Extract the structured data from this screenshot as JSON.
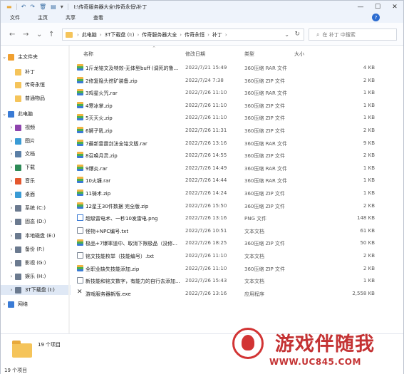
{
  "titlebar": {
    "path": "I:\\传奇服务器大全\\传奇永恒\\补丁",
    "icons": [
      "folder-icon",
      "undo-icon",
      "redo-icon",
      "delete-icon",
      "properties-icon",
      "dropdown-icon"
    ]
  },
  "window_controls": {
    "minimize": "—",
    "maximize": "☐",
    "close": "✕"
  },
  "ribbon": {
    "tabs": [
      "文件",
      "主页",
      "共享",
      "查看"
    ],
    "help": "?"
  },
  "nav": {
    "back": "←",
    "forward": "→",
    "recent": "⌄",
    "up": "↑"
  },
  "address": {
    "crumbs": [
      "此电脑",
      "3T下载盘 (I:)",
      "传奇服务器大全",
      "传奇永恒",
      "补丁"
    ],
    "separator": "›",
    "dropdown": "⌄",
    "refresh": "↻"
  },
  "search": {
    "placeholder": "在 补丁 中搜索",
    "icon": "⌕"
  },
  "sidebar": {
    "items": [
      {
        "label": "主文件夹",
        "chev": "⌄",
        "icon": "home",
        "color": "#f0a030",
        "indent": 0
      },
      {
        "label": "补丁",
        "chev": "",
        "icon": "folder",
        "color": "#f5c45a",
        "indent": 1
      },
      {
        "label": "传奇永恒",
        "chev": "",
        "icon": "folder",
        "color": "#f5c45a",
        "indent": 1
      },
      {
        "label": "普通物品",
        "chev": "",
        "icon": "folder",
        "color": "#f5c45a",
        "indent": 1
      },
      {
        "label": "此电脑",
        "chev": "⌄",
        "icon": "pc",
        "color": "#3a7bd5",
        "indent": 0
      },
      {
        "label": "视频",
        "chev": "›",
        "icon": "video",
        "color": "#8e44ad",
        "indent": 1
      },
      {
        "label": "图片",
        "chev": "›",
        "icon": "pictures",
        "color": "#3a9bd5",
        "indent": 1
      },
      {
        "label": "文档",
        "chev": "›",
        "icon": "documents",
        "color": "#5b7fa6",
        "indent": 1
      },
      {
        "label": "下载",
        "chev": "›",
        "icon": "download",
        "color": "#2e8b57",
        "indent": 1
      },
      {
        "label": "音乐",
        "chev": "›",
        "icon": "music",
        "color": "#e4572e",
        "indent": 1
      },
      {
        "label": "桌面",
        "chev": "›",
        "icon": "desktop",
        "color": "#3a9bd5",
        "indent": 1
      },
      {
        "label": "系统 (C:)",
        "chev": "›",
        "icon": "drive",
        "color": "#6b7a8f",
        "indent": 1
      },
      {
        "label": "固态 (D:)",
        "chev": "›",
        "icon": "drive",
        "color": "#6b7a8f",
        "indent": 1
      },
      {
        "label": "本地磁盘 (E:)",
        "chev": "›",
        "icon": "drive",
        "color": "#6b7a8f",
        "indent": 1
      },
      {
        "label": "备份 (F:)",
        "chev": "›",
        "icon": "drive",
        "color": "#6b7a8f",
        "indent": 1
      },
      {
        "label": "影视 (G:)",
        "chev": "›",
        "icon": "drive",
        "color": "#6b7a8f",
        "indent": 1
      },
      {
        "label": "娱乐 (H:)",
        "chev": "›",
        "icon": "drive",
        "color": "#6b7a8f",
        "indent": 1
      },
      {
        "label": "3T下载盘 (I:)",
        "chev": "›",
        "icon": "drive",
        "color": "#6b7a8f",
        "indent": 1,
        "selected": true
      },
      {
        "label": "网络",
        "chev": "›",
        "icon": "network",
        "color": "#3a7bd5",
        "indent": 0
      }
    ]
  },
  "columns": {
    "name": "名称",
    "date": "修改日期",
    "type": "类型",
    "size": "大小",
    "sort_caret": "^"
  },
  "files": [
    {
      "name": "1斤龙铭文及特效-无体型buff (调死的鲁...",
      "date": "2022/7/21 15:49",
      "type": "360压缩 RAR 文件",
      "size": "4 KB",
      "kind": "archive"
    },
    {
      "name": "2修复隐头挖矿装备.zip",
      "date": "2022/7/24 7:38",
      "type": "360压缩 ZIP 文件",
      "size": "2 KB",
      "kind": "archive"
    },
    {
      "name": "3鸡星火咒.rar",
      "date": "2022/7/26 11:10",
      "type": "360压缩 RAR 文件",
      "size": "1 KB",
      "kind": "archive"
    },
    {
      "name": "4寒冰掌.zip",
      "date": "2022/7/26 11:10",
      "type": "360压缩 ZIP 文件",
      "size": "1 KB",
      "kind": "archive"
    },
    {
      "name": "5灭天火.zip",
      "date": "2022/7/26 11:10",
      "type": "360压缩 ZIP 文件",
      "size": "1 KB",
      "kind": "archive"
    },
    {
      "name": "6狮子吼.zip",
      "date": "2022/7/26 11:31",
      "type": "360压缩 ZIP 文件",
      "size": "2 KB",
      "kind": "archive"
    },
    {
      "name": "7最新雷霆剑法全铭文版.rar",
      "date": "2022/7/26 13:16",
      "type": "360压缩 RAR 文件",
      "size": "9 KB",
      "kind": "archive"
    },
    {
      "name": "8召唤月灵.zip",
      "date": "2022/7/26 14:55",
      "type": "360压缩 ZIP 文件",
      "size": "2 KB",
      "kind": "archive"
    },
    {
      "name": "9爆炎.rar",
      "date": "2022/7/26 14:49",
      "type": "360压缩 RAR 文件",
      "size": "1 KB",
      "kind": "archive"
    },
    {
      "name": "10火镰.rar",
      "date": "2022/7/26 14:44",
      "type": "360压缩 RAR 文件",
      "size": "1 KB",
      "kind": "archive"
    },
    {
      "name": "11骑术.zip",
      "date": "2022/7/26 14:24",
      "type": "360压缩 ZIP 文件",
      "size": "1 KB",
      "kind": "archive"
    },
    {
      "name": "12星王30件数据 完全版.zip",
      "date": "2022/7/26 15:50",
      "type": "360压缩 ZIP 文件",
      "size": "2 KB",
      "kind": "archive"
    },
    {
      "name": "超级雷电术、一秒10发雷电.png",
      "date": "2022/7/26 13:16",
      "type": "PNG 文件",
      "size": "148 KB",
      "kind": "image"
    },
    {
      "name": "怪物+NPC编号.txt",
      "date": "2022/7/26 10:51",
      "type": "文本文档",
      "size": "61 KB",
      "kind": "text"
    },
    {
      "name": "极品+7爆率道中、取消下限极品（没修...",
      "date": "2022/7/26 18:25",
      "type": "360压缩 ZIP 文件",
      "size": "50 KB",
      "kind": "archive"
    },
    {
      "name": "铭文技能枚举（技能编号）.txt",
      "date": "2022/7/26 11:10",
      "type": "文本文档",
      "size": "2 KB",
      "kind": "text"
    },
    {
      "name": "全职业缺失技能添加.zip",
      "date": "2022/7/26 11:10",
      "type": "360压缩 ZIP 文件",
      "size": "2 KB",
      "kind": "archive"
    },
    {
      "name": "新技能和铭文数字，有能力的自行去添加...",
      "date": "2022/7/26 15:43",
      "type": "文本文档",
      "size": "1 KB",
      "kind": "text"
    },
    {
      "name": "游戏服务器新版.exe",
      "date": "2022/7/26 13:16",
      "type": "应用程序",
      "size": "2,558 KB",
      "kind": "exe"
    }
  ],
  "details": {
    "count": "19 个项目"
  },
  "statusbar": {
    "count": "19 个项目"
  },
  "watermark": {
    "brand": "游戏伴随我",
    "url": "WWW.UC845.COM",
    "logo": "lion-logo"
  }
}
